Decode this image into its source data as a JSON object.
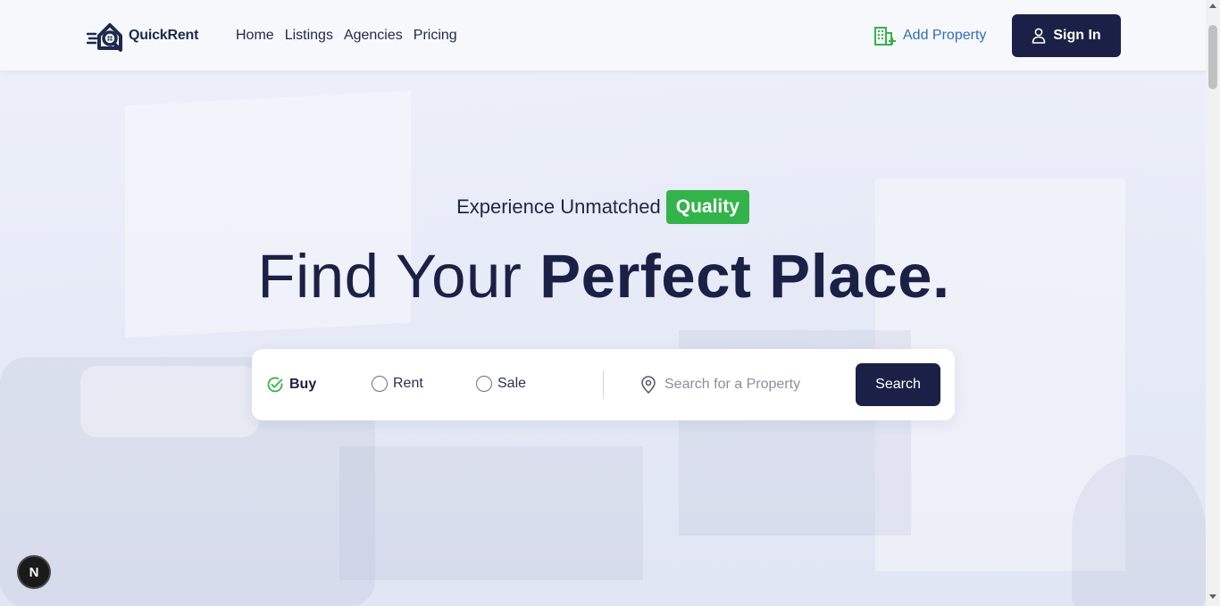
{
  "brand": {
    "name": "QuickRent",
    "icon": "house-logo-icon"
  },
  "nav": {
    "items": [
      {
        "label": "Home"
      },
      {
        "label": "Listings"
      },
      {
        "label": "Agencies"
      },
      {
        "label": "Pricing"
      }
    ]
  },
  "header": {
    "add_property_label": "Add Property",
    "add_property_icon": "building-plus-icon",
    "signin_label": "Sign In",
    "signin_icon": "user-icon"
  },
  "hero": {
    "tagline": "Experience Unmatched",
    "badge": "Quality",
    "headline_light": "Find Your",
    "headline_bold": "Perfect Place."
  },
  "search": {
    "options": [
      {
        "label": "Buy",
        "selected": true
      },
      {
        "label": "Rent",
        "selected": false
      },
      {
        "label": "Sale",
        "selected": false
      }
    ],
    "placeholder": "Search for a Property",
    "button_label": "Search",
    "location_icon": "map-pin-icon"
  },
  "dev_badge": {
    "label": "N"
  },
  "colors": {
    "primary": "#1b2146",
    "accent_green": "#33b44a",
    "link_blue": "#2f6fb6"
  }
}
